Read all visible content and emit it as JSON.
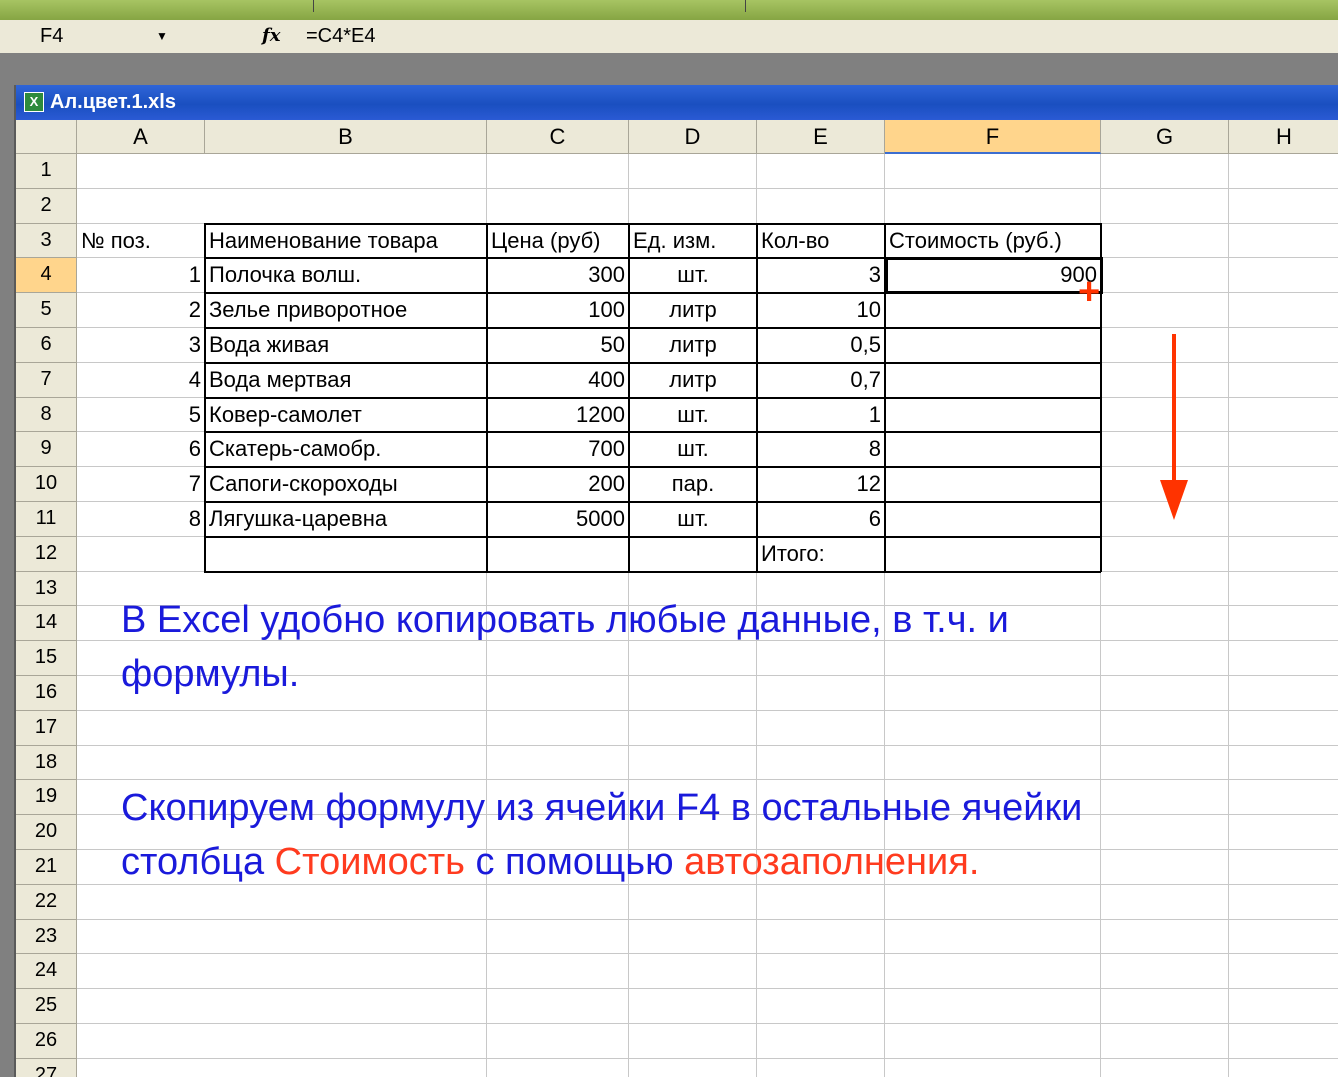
{
  "formula_bar": {
    "name_box": "F4",
    "formula": "=C4*E4"
  },
  "workbook": {
    "title": "Ал.цвет.1.xls"
  },
  "sheet": {
    "columns": [
      "A",
      "B",
      "C",
      "D",
      "E",
      "F",
      "G",
      "H"
    ],
    "rows": [
      "1",
      "2",
      "3",
      "4",
      "5",
      "6",
      "7",
      "8",
      "9",
      "10",
      "11",
      "12",
      "13",
      "14",
      "15",
      "16",
      "17",
      "18",
      "19",
      "20",
      "21",
      "22",
      "23",
      "24",
      "25",
      "26",
      "27"
    ],
    "active_cell": "F4",
    "header": [
      "№ поз.",
      "Наименование товара",
      "Цена (руб)",
      "Ед. изм.",
      "Кол-во",
      "Стоимость (руб.)"
    ],
    "data_rows": [
      [
        "1",
        "Полочка волш.",
        "300",
        "шт.",
        "3",
        "900"
      ],
      [
        "2",
        "Зелье приворотное",
        "100",
        "литр",
        "10",
        ""
      ],
      [
        "3",
        "Вода живая",
        "50",
        "литр",
        "0,5",
        ""
      ],
      [
        "4",
        "Вода мертвая",
        "400",
        "литр",
        "0,7",
        ""
      ],
      [
        "5",
        "Ковер-самолет",
        "1200",
        "шт.",
        "1",
        ""
      ],
      [
        "6",
        "Скатерь-самобр.",
        "700",
        "шт.",
        "8",
        ""
      ],
      [
        "7",
        "Сапоги-скороходы",
        "200",
        "пар.",
        "12",
        ""
      ],
      [
        "8",
        "Лягушка-царевна",
        "5000",
        "шт.",
        "6",
        ""
      ]
    ],
    "total_label": "Итого:"
  },
  "notes": {
    "line1": "В Excel удобно копировать любые данные, в т.ч. и",
    "line2": "формулы.",
    "line3": "Скопируем формулу из ячейки F4 в остальные ячейки",
    "line4_a": "столбца ",
    "line4_b": "Стоимость",
    "line4_c": " с помощью ",
    "line4_d": "автозаполнения",
    "line4_e": "."
  },
  "colors": {
    "note_text": "#1a1adb",
    "note_highlight": "#ff3b1f",
    "arrow": "#ff3300",
    "title_bar": "#1a4fc0"
  }
}
